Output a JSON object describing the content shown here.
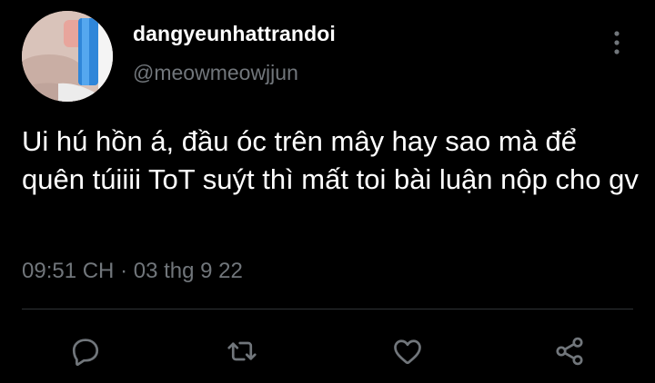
{
  "tweet": {
    "author": {
      "display_name": "dangyeunhattrandoi",
      "handle": "@meowmeowjjun",
      "avatar_icon": "profile-photo"
    },
    "text": "Ui hú hồn á, đầu óc trên mây hay sao mà để quên túiiii ToT suýt thì mất toi bài luận nộp cho gv",
    "time": "09:51 CH",
    "separator": "·",
    "date": "03 thg 9 22"
  },
  "actions": {
    "reply_icon": "reply-icon",
    "retweet_icon": "retweet-icon",
    "like_icon": "heart-icon",
    "share_icon": "share-icon",
    "more_icon": "more-vertical-icon"
  },
  "colors": {
    "background": "#000000",
    "primary_text": "#ffffff",
    "secondary_text": "#71767b",
    "divider": "#2f3336"
  }
}
